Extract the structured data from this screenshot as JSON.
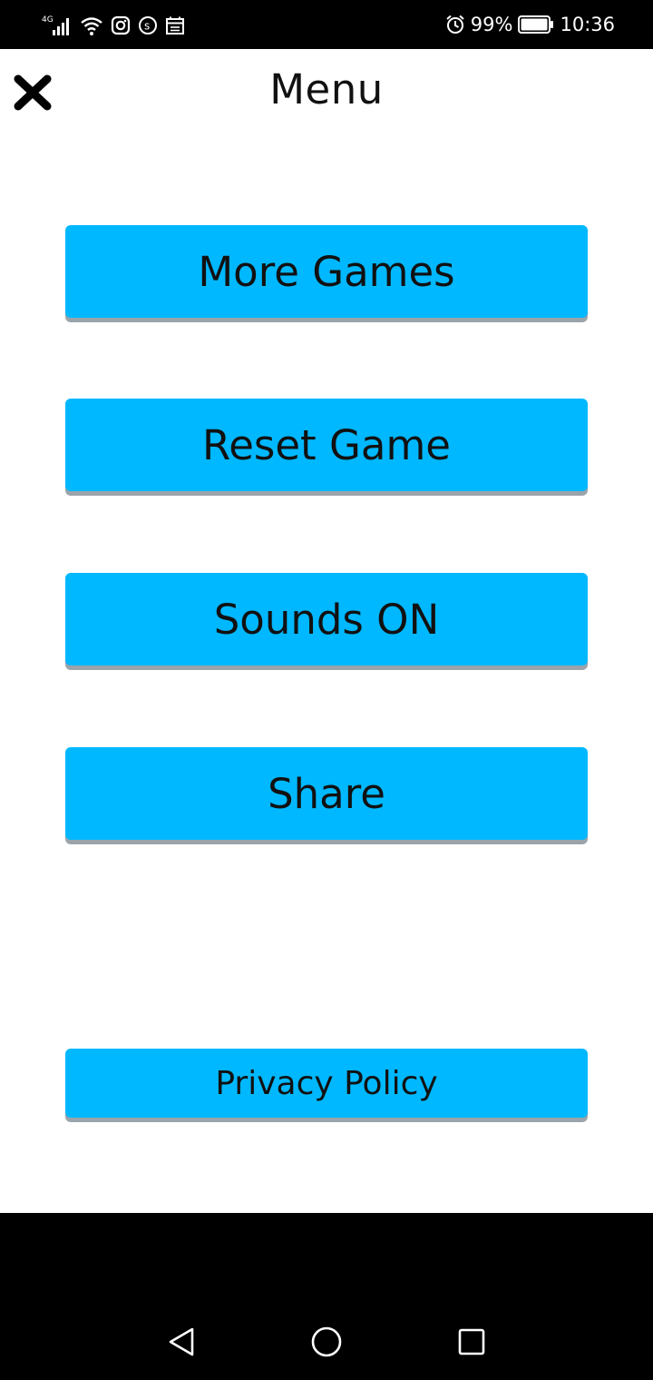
{
  "status_bar": {
    "network_label": "4G",
    "battery_percent": "99%",
    "time": "10:36",
    "icons": [
      "signal-icon",
      "wifi-icon",
      "instagram-icon",
      "s-app-icon",
      "calendar-icon",
      "alarm-icon",
      "battery-icon"
    ]
  },
  "header": {
    "title": "Menu",
    "close_icon": "close-icon"
  },
  "menu": {
    "more_games": "More Games",
    "reset_game": "Reset Game",
    "sounds": "Sounds ON",
    "share": "Share",
    "privacy_policy": "Privacy Policy"
  },
  "nav_bar": {
    "icons": [
      "back-icon",
      "home-icon",
      "recents-icon"
    ]
  },
  "colors": {
    "button": "#00b8ff",
    "button_shadow": "#9aa4aa",
    "background": "#ffffff",
    "system_bars": "#000000"
  }
}
